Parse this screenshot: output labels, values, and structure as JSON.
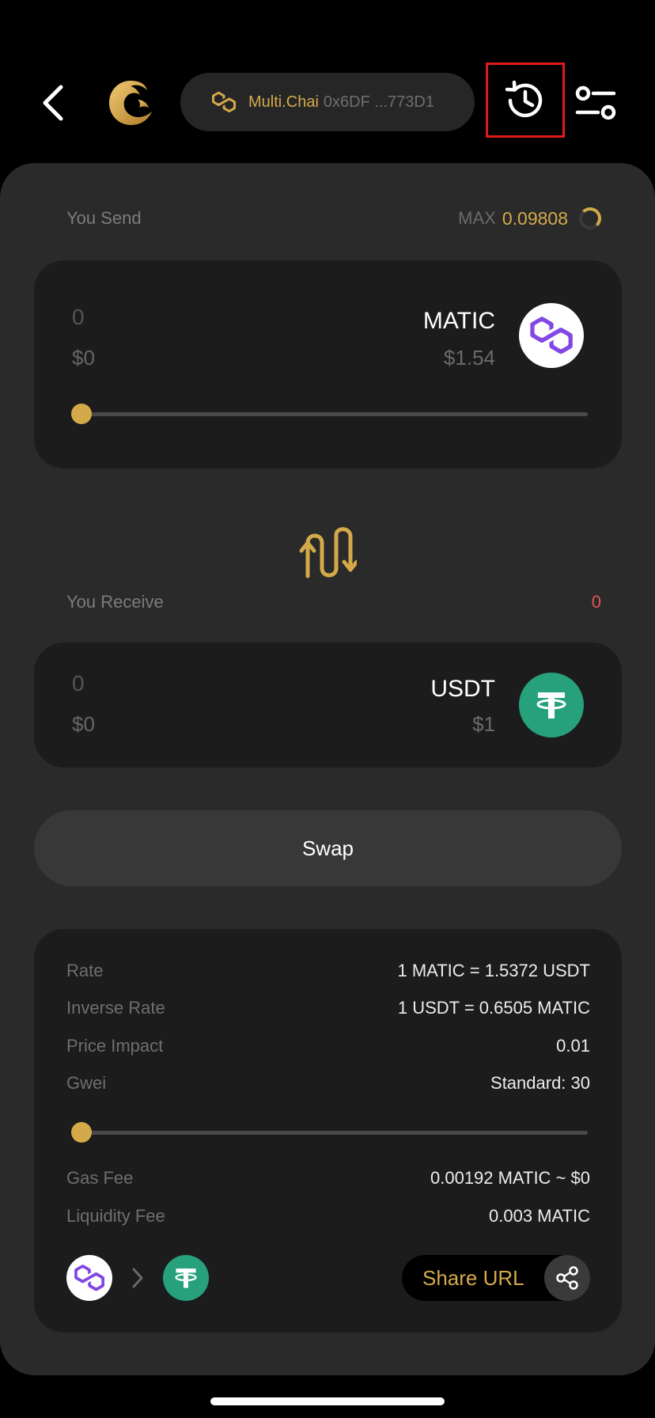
{
  "header": {
    "chain_name": "Multi.Chai",
    "wallet_address": "0x6DF ...773D1"
  },
  "send": {
    "label": "You Send",
    "max_label": "MAX",
    "max_value": "0.09808",
    "amount": "0",
    "usd_value": "$0",
    "token": "MATIC",
    "token_price": "$1.54",
    "slider_percent": 0
  },
  "receive": {
    "label": "You Receive",
    "value": "0",
    "amount": "0",
    "usd_value": "$0",
    "token": "USDT",
    "token_price": "$1"
  },
  "swap_button": "Swap",
  "details": {
    "rate_label": "Rate",
    "rate_value": "1 MATIC = 1.5372 USDT",
    "inverse_rate_label": "Inverse Rate",
    "inverse_rate_value": "1 USDT = 0.6505 MATIC",
    "price_impact_label": "Price Impact",
    "price_impact_value": "0.01",
    "gwei_label": "Gwei",
    "gwei_value": "Standard: 30",
    "gwei_slider_percent": 0,
    "gas_fee_label": "Gas Fee",
    "gas_fee_value": "0.00192 MATIC ~ $0",
    "liquidity_fee_label": "Liquidity Fee",
    "liquidity_fee_value": "0.003 MATIC",
    "share_label": "Share URL"
  },
  "colors": {
    "accent": "#d4a94a",
    "matic": "#8247e5",
    "usdt": "#26a17b",
    "highlight_border": "#e01a1a",
    "negative": "#e05555"
  },
  "icons": {
    "back": "chevron-left-icon",
    "logo": "dragon-logo-icon",
    "chain": "polygon-icon",
    "history": "history-icon",
    "settings": "sliders-icon",
    "swap_direction": "swap-arrows-icon",
    "share": "share-icon"
  }
}
